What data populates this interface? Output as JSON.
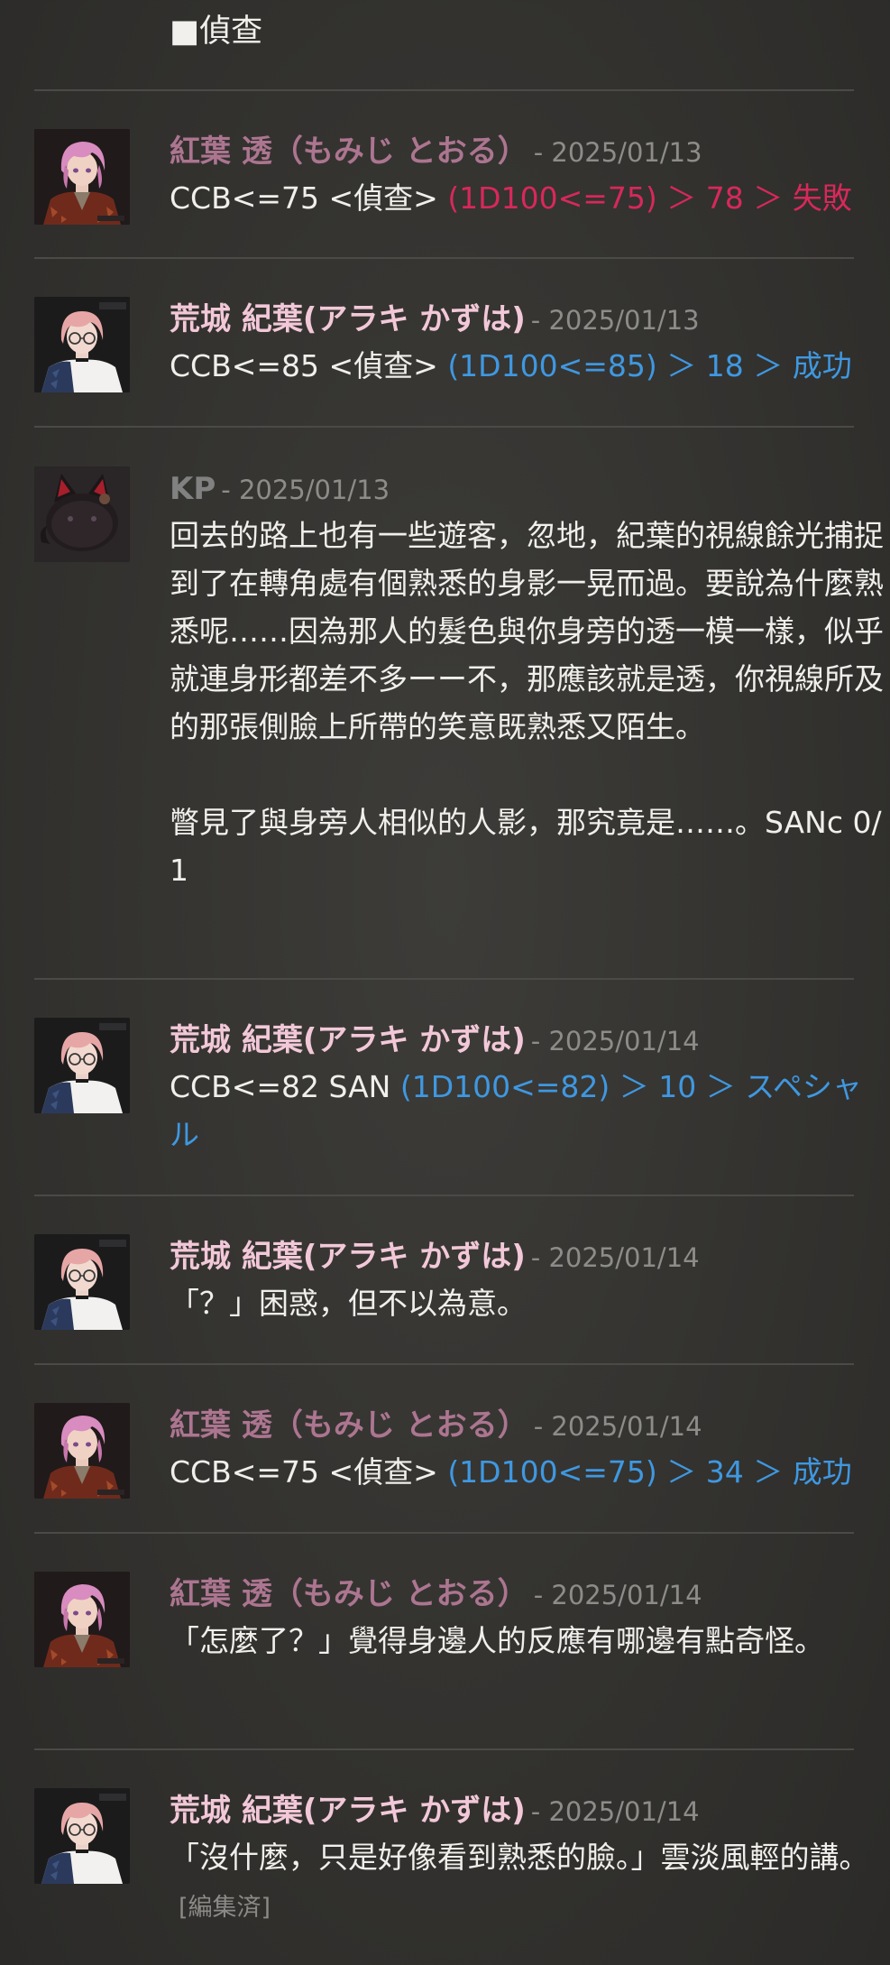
{
  "top_line": "■偵查",
  "messages": [
    {
      "speaker": "紅葉 透（もみじ とおる）",
      "date": "- 2025/01/13",
      "command": "CCB<=75 <偵查>",
      "result": "(1D100<=75) ＞ 78 ＞ 失敗",
      "result_color": "#d8285a"
    },
    {
      "speaker": "荒城 紀葉(アラキ かずは)",
      "date": "- 2025/01/13",
      "command": "CCB<=85 <偵查>",
      "result": "(1D100<=85) ＞ 18 ＞ 成功",
      "result_color": "#3f98e1"
    },
    {
      "speaker": "KP",
      "date": "- 2025/01/13",
      "paragraph1": "回去的路上也有一些遊客，忽地，紀葉的視線餘光捕捉到了在轉角處有個熟悉的身影一晃而過。要說為什麼熟悉呢……因為那人的髮色與你身旁的透一模一樣，似乎就連身形都差不多ーー不，那應該就是透，你視線所及的那張側臉上所帶的笑意既熟悉又陌生。",
      "paragraph2": "瞥見了與身旁人相似的人影，那究竟是……。SANc 0/1"
    },
    {
      "speaker": "荒城 紀葉(アラキ かずは)",
      "date": "- 2025/01/14",
      "command": "CCB<=82 SAN",
      "result": "(1D100<=82) ＞ 10 ＞ スペシャル",
      "result_color": "#3f98e1"
    },
    {
      "speaker": "荒城 紀葉(アラキ かずは)",
      "date": "- 2025/01/14",
      "text": "「？」困惑，但不以為意。"
    },
    {
      "speaker": "紅葉 透（もみじ とおる）",
      "date": "- 2025/01/14",
      "command": "CCB<=75 <偵查>",
      "result": "(1D100<=75) ＞ 34 ＞ 成功",
      "result_color": "#3f98e1"
    },
    {
      "speaker": "紅葉 透（もみじ とおる）",
      "date": "- 2025/01/14",
      "text": "「怎麼了？」覺得身邊人的反應有哪邊有點奇怪。"
    },
    {
      "speaker": "荒城 紀葉(アラキ かずは)",
      "date": "- 2025/01/14",
      "text": "「沒什麼，只是好像看到熟悉的臉。」雲淡風輕的講。",
      "edited": "[編集済]"
    }
  ],
  "colors": {
    "speaker_momiji": "#ac7590",
    "speaker_arashiro": "#f2c8d8",
    "speaker_kp": "#818181",
    "dice_fail": "#d8285a",
    "dice_success": "#3f98e1",
    "date": "#8d8c89"
  },
  "icons": {
    "avatar_momiji": "pink-haired-boy-avatar-icon",
    "avatar_arashiro": "pink-haired-glasses-avatar-icon",
    "avatar_kp": "black-cat-avatar-icon"
  }
}
